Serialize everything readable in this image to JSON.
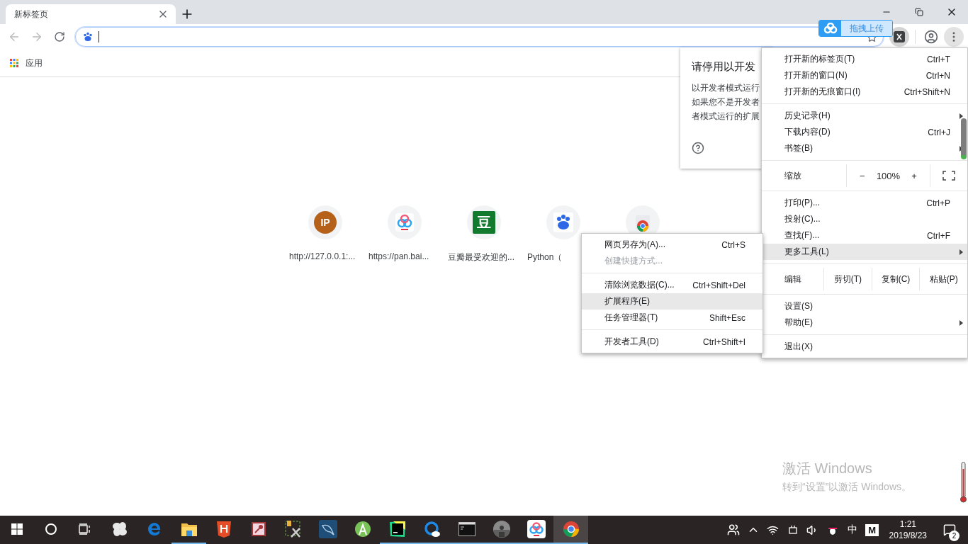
{
  "tab": {
    "title": "新标签页"
  },
  "bookmarks": [
    {
      "label": "应用"
    }
  ],
  "shortcuts": [
    {
      "kind": "letter",
      "title": "http://127.0.0.1:...",
      "letter": "IP"
    },
    {
      "kind": "icon",
      "title": "https://pan.bai..."
    },
    {
      "kind": "letter",
      "title": "豆瓣最受欢迎的...",
      "letter": "豆"
    },
    {
      "kind": "icon",
      "title": "Python（"
    },
    {
      "kind": "icon"
    }
  ],
  "extension_bubble": {
    "title": "请停用以开发",
    "lines": [
      "以开发者模式运行",
      "如果您不是开发者",
      "者模式运行的扩展"
    ]
  },
  "upload_widget": {
    "label": "拖拽上传"
  },
  "menu": [
    {
      "kind": "item",
      "label": "打开新的标签页(T)",
      "shortcut": "Ctrl+T",
      "selected": false
    },
    {
      "kind": "item",
      "label": "打开新的窗口(N)",
      "shortcut": "Ctrl+N",
      "selected": false
    },
    {
      "kind": "item",
      "label": "打开新的无痕窗口(I)",
      "shortcut": "Ctrl+Shift+N",
      "selected": false
    },
    {
      "kind": "separator"
    },
    {
      "kind": "item",
      "label": "历史记录(H)",
      "submenu": true,
      "selected": false
    },
    {
      "kind": "item",
      "label": "下载内容(D)",
      "shortcut": "Ctrl+J",
      "selected": false
    },
    {
      "kind": "item",
      "label": "书签(B)",
      "submenu": true,
      "selected": false
    },
    {
      "kind": "separator"
    },
    {
      "kind": "zoom",
      "label": "缩放",
      "minus": "−",
      "value": "100%",
      "plus": "+"
    },
    {
      "kind": "separator"
    },
    {
      "kind": "item",
      "label": "打印(P)...",
      "shortcut": "Ctrl+P",
      "selected": false
    },
    {
      "kind": "item",
      "label": "投射(C)...",
      "selected": false
    },
    {
      "kind": "item",
      "label": "查找(F)...",
      "shortcut": "Ctrl+F",
      "selected": false
    },
    {
      "kind": "item",
      "label": "更多工具(L)",
      "submenu": true,
      "selected": true
    },
    {
      "kind": "separator"
    },
    {
      "kind": "edit",
      "label": "编辑",
      "actions": [
        "剪切(T)",
        "复制(C)",
        "粘贴(P)"
      ]
    },
    {
      "kind": "separator"
    },
    {
      "kind": "item",
      "label": "设置(S)",
      "selected": false
    },
    {
      "kind": "item",
      "label": "帮助(E)",
      "submenu": true,
      "selected": false
    },
    {
      "kind": "separator"
    },
    {
      "kind": "item",
      "label": "退出(X)",
      "selected": false
    }
  ],
  "submenu": [
    {
      "kind": "item",
      "label": "网页另存为(A)...",
      "shortcut": "Ctrl+S",
      "selected": false,
      "disabled": false
    },
    {
      "kind": "item",
      "label": "创建快捷方式...",
      "selected": false,
      "disabled": true
    },
    {
      "kind": "separator"
    },
    {
      "kind": "item",
      "label": "清除浏览数据(C)...",
      "shortcut": "Ctrl+Shift+Del",
      "selected": false,
      "disabled": false
    },
    {
      "kind": "item",
      "label": "扩展程序(E)",
      "selected": true,
      "disabled": false
    },
    {
      "kind": "item",
      "label": "任务管理器(T)",
      "shortcut": "Shift+Esc",
      "selected": false,
      "disabled": false
    },
    {
      "kind": "separator"
    },
    {
      "kind": "item",
      "label": "开发者工具(D)",
      "shortcut": "Ctrl+Shift+I",
      "selected": false,
      "disabled": false
    }
  ],
  "activation": {
    "title": "激活 Windows",
    "subtitle": "转到“设置”以激活 Windows。"
  },
  "taskbar": {
    "apps": [
      {
        "running": false,
        "selected": false
      },
      {
        "running": false,
        "selected": false
      },
      {
        "running": true,
        "selected": false
      },
      {
        "running": false,
        "selected": false
      },
      {
        "running": false,
        "selected": false
      },
      {
        "running": false,
        "selected": false
      },
      {
        "running": false,
        "selected": false
      },
      {
        "running": false,
        "selected": false
      },
      {
        "running": true,
        "selected": false
      },
      {
        "running": true,
        "selected": false
      },
      {
        "running": true,
        "selected": false
      },
      {
        "running": true,
        "selected": false
      },
      {
        "running": true,
        "selected": false
      },
      {
        "running": true,
        "selected": true
      }
    ],
    "ime": "中",
    "mail_key": "M",
    "time": "1:21",
    "date": "2019/8/23",
    "notifications": "2"
  }
}
